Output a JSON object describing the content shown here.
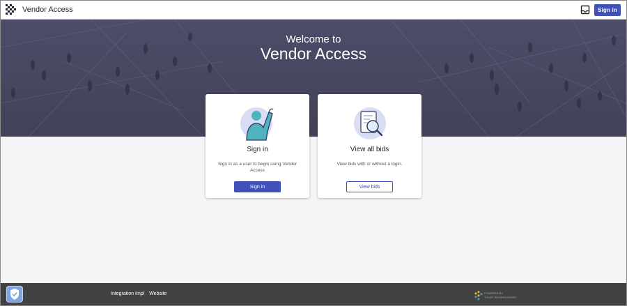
{
  "header": {
    "app_title": "Vendor Access",
    "signin_label": "Sign in",
    "icons": [
      "vendor-access-logo",
      "tray-icon"
    ]
  },
  "hero": {
    "welcome_line1": "Welcome to",
    "welcome_line2": "Vendor Access"
  },
  "cards": [
    {
      "icon": "raised-hand-person",
      "title": "Sign in",
      "description": "Sign in as a user to begin using Vendor Access",
      "button_label": "Sign in"
    },
    {
      "icon": "magnifier-document",
      "title": "View all bids",
      "description": "View bids with or without a login.",
      "button_label": "View bids"
    }
  ],
  "footer": {
    "links": [
      "Integration Impl",
      "Website"
    ],
    "powered_by_line1": "POWERED BY",
    "powered_by_line2": "TYLER TECHNOLOGIES",
    "icons": [
      "shield-icon",
      "tyler-logo"
    ]
  },
  "colors": {
    "primary": "#3f51b5",
    "hero_overlay": "#46475f",
    "footer": "#424242",
    "page_background": "#f5f5f7"
  }
}
